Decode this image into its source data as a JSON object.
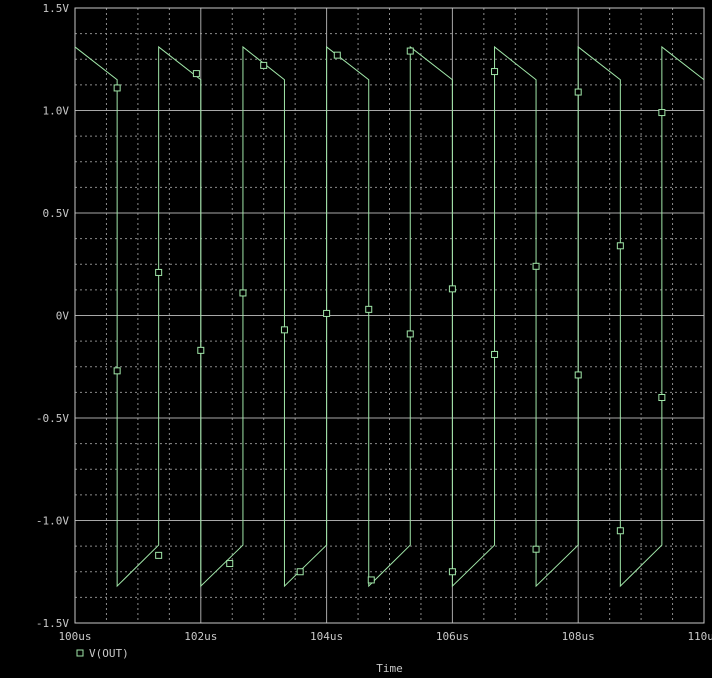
{
  "chart_data": {
    "type": "line",
    "xlabel": "Time",
    "ylabel": "",
    "xlim": [
      100,
      110
    ],
    "ylim": [
      -1.5,
      1.5
    ],
    "x_unit": "us",
    "x_ticks": [
      100,
      102,
      104,
      106,
      108,
      110
    ],
    "x_tick_labels": [
      "100us",
      "102us",
      "104us",
      "106us",
      "108us",
      "110us"
    ],
    "y_ticks": [
      1.5,
      1.0,
      0.5,
      0,
      -0.5,
      -1.0,
      -1.5
    ],
    "y_tick_labels": [
      "1.5V",
      "1.0V",
      "0.5V",
      "0V",
      "-0.5V",
      "-1.0V",
      "-1.5V"
    ],
    "grid": true,
    "legend": "bottom-left",
    "colors": {
      "background": "#000000",
      "trace": "#a0e6a8",
      "grid": "#8a8a8a",
      "axis": "#c8c8c8"
    },
    "series": [
      {
        "name": "V(OUT)",
        "x": [
          100.0,
          100.67,
          100.67,
          101.33,
          101.33,
          102.0,
          102.0,
          102.67,
          102.67,
          103.33,
          103.33,
          104.0,
          104.0,
          104.67,
          104.67,
          105.33,
          105.33,
          106.0,
          106.0,
          106.67,
          106.67,
          107.33,
          107.33,
          108.0,
          108.0,
          108.67,
          108.67,
          109.33,
          109.33,
          110.0
        ],
        "y": [
          1.31,
          1.15,
          -1.32,
          -1.12,
          1.31,
          1.15,
          -1.32,
          -1.12,
          1.31,
          1.15,
          -1.32,
          -1.12,
          1.31,
          1.15,
          -1.32,
          -1.12,
          1.31,
          1.15,
          -1.32,
          -1.12,
          1.31,
          1.15,
          -1.32,
          -1.12,
          1.31,
          1.15,
          -1.32,
          -1.12,
          1.31,
          1.15
        ]
      }
    ],
    "markers": {
      "x": [
        100.67,
        100.67,
        101.33,
        101.33,
        101.93,
        102.0,
        102.46,
        102.67,
        103.0,
        103.33,
        103.58,
        104.0,
        104.17,
        104.67,
        104.71,
        105.33,
        105.33,
        106.0,
        106.0,
        106.67,
        106.67,
        107.33,
        107.33,
        108.0,
        108.0,
        108.67,
        108.67,
        109.33,
        109.33
      ],
      "y": [
        1.11,
        -0.27,
        0.21,
        -1.17,
        1.18,
        -0.17,
        -1.21,
        0.11,
        1.22,
        -0.07,
        -1.25,
        0.01,
        1.27,
        0.03,
        -1.29,
        -0.09,
        1.29,
        0.13,
        -1.25,
        -0.19,
        1.19,
        0.24,
        -1.14,
        -0.29,
        1.09,
        0.34,
        -1.05,
        -0.4,
        0.99
      ]
    }
  }
}
